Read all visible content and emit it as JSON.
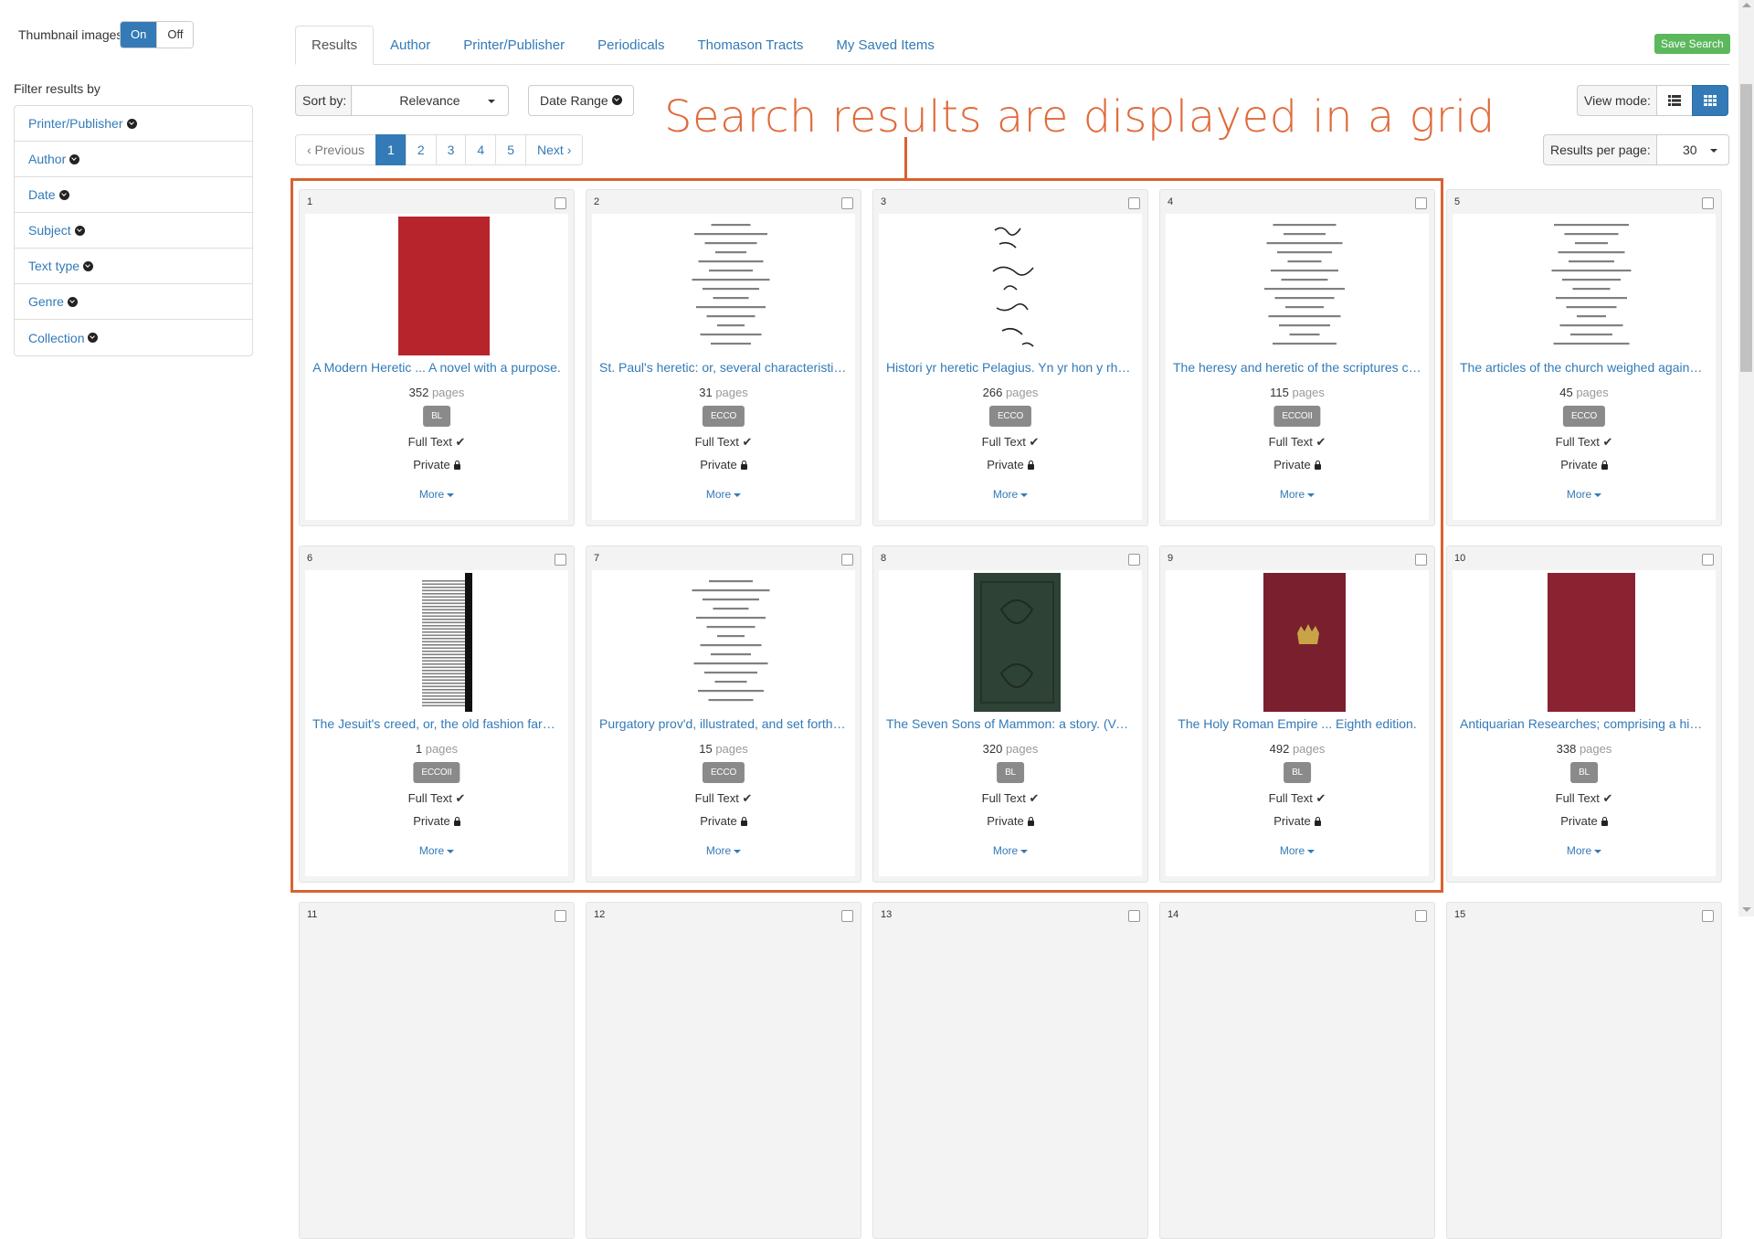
{
  "thumbnails": {
    "label": "Thumbnail images:",
    "on": "On",
    "off": "Off"
  },
  "sidebar": {
    "title": "Filter results by",
    "items": [
      {
        "label": "Printer/Publisher"
      },
      {
        "label": "Author"
      },
      {
        "label": "Date"
      },
      {
        "label": "Subject"
      },
      {
        "label": "Text type"
      },
      {
        "label": "Genre"
      },
      {
        "label": "Collection"
      }
    ]
  },
  "tabs": [
    {
      "label": "Results",
      "active": true
    },
    {
      "label": "Author"
    },
    {
      "label": "Printer/Publisher"
    },
    {
      "label": "Periodicals"
    },
    {
      "label": "Thomason Tracts"
    },
    {
      "label": "My Saved Items"
    }
  ],
  "save_search": "Save Search",
  "sort": {
    "label": "Sort by:",
    "value": "Relevance"
  },
  "date_range": "Date Range",
  "view_mode": {
    "label": "View mode:",
    "selected": "grid"
  },
  "pagination": {
    "previous": "‹ Previous",
    "pages": [
      "1",
      "2",
      "3",
      "4",
      "5"
    ],
    "current": "1",
    "next": "Next ›"
  },
  "results_per_page": {
    "label": "Results per page:",
    "value": "30"
  },
  "annotation": "Search results are displayed in a grid",
  "labels": {
    "pages": "pages",
    "full_text": "Full Text",
    "private": "Private",
    "more": "More"
  },
  "colors": {
    "accent": "#337ab7",
    "annotation": "#d9622f",
    "save": "#5cb85c",
    "badge": "#8a8a8a"
  },
  "results": [
    {
      "num": "1",
      "title": "A Modern Heretic ... A novel with a purpose.",
      "pages": "352",
      "source": "BL",
      "cover": "red"
    },
    {
      "num": "2",
      "title": "St. Paul's heretic: or, several characteristics of...",
      "pages": "31",
      "source": "ECCO",
      "cover": "print"
    },
    {
      "num": "3",
      "title": "Histori yr heretic Pelagius. Yn yr hon y rhoddir...",
      "pages": "266",
      "source": "ECCO",
      "cover": "handwriting"
    },
    {
      "num": "4",
      "title": "The heresy and heretic of the scriptures comp...",
      "pages": "115",
      "source": "ECCOII",
      "cover": "print"
    },
    {
      "num": "5",
      "title": "The articles of the church weighed against the...",
      "pages": "45",
      "source": "ECCO",
      "cover": "print"
    },
    {
      "num": "6",
      "title": "The Jesuit's creed, or, the old fashion farmer's...",
      "pages": "1",
      "source": "ECCOII",
      "cover": "dense"
    },
    {
      "num": "7",
      "title": "Purgatory prov'd, illustrated, and set forth in a ...",
      "pages": "15",
      "source": "ECCO",
      "cover": "print"
    },
    {
      "num": "8",
      "title": "The Seven Sons of Mammon: a story. (Volum...",
      "pages": "320",
      "source": "BL",
      "cover": "green"
    },
    {
      "num": "9",
      "title": "The Holy Roman Empire ... Eighth edition.",
      "pages": "492",
      "source": "BL",
      "cover": "maroon-crest"
    },
    {
      "num": "10",
      "title": "Antiquarian Researches; comprising a history ...",
      "pages": "338",
      "source": "BL",
      "cover": "maroon"
    },
    {
      "num": "11"
    },
    {
      "num": "12"
    },
    {
      "num": "13"
    },
    {
      "num": "14"
    },
    {
      "num": "15"
    }
  ]
}
